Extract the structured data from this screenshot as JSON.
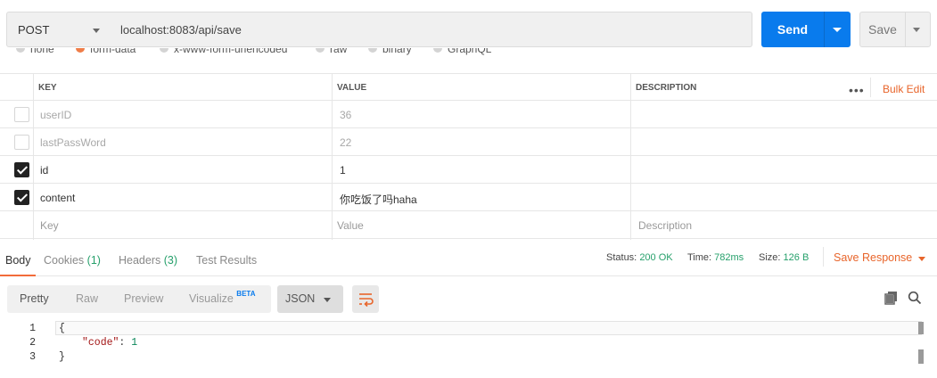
{
  "request": {
    "method": "POST",
    "url": "localhost:8083/api/save",
    "send_label": "Send",
    "save_label": "Save"
  },
  "body_types": [
    {
      "label": "none",
      "selected": false
    },
    {
      "label": "form-data",
      "selected": true
    },
    {
      "label": "x-www-form-urlencoded",
      "selected": false
    },
    {
      "label": "raw",
      "selected": false
    },
    {
      "label": "binary",
      "selected": false
    },
    {
      "label": "GraphQL",
      "selected": false
    }
  ],
  "table": {
    "headers": {
      "key": "KEY",
      "value": "VALUE",
      "description": "DESCRIPTION"
    },
    "more_label": "•••",
    "bulk_edit_label": "Bulk Edit",
    "rows": [
      {
        "checked": false,
        "key": "userID",
        "value": "36",
        "description": ""
      },
      {
        "checked": false,
        "key": "lastPassWord",
        "value": "22",
        "description": ""
      },
      {
        "checked": true,
        "key": "id",
        "value": "1",
        "description": ""
      },
      {
        "checked": true,
        "key": "content",
        "value": "你吃饭了吗haha",
        "description": ""
      }
    ],
    "placeholders": {
      "key": "Key",
      "value": "Value",
      "description": "Description"
    }
  },
  "response": {
    "tabs": [
      {
        "label": "Body",
        "count": ""
      },
      {
        "label": "Cookies",
        "count": "(1)"
      },
      {
        "label": "Headers",
        "count": "(3)"
      },
      {
        "label": "Test Results",
        "count": ""
      }
    ],
    "status_label": "Status:",
    "status_value": "200 OK",
    "time_label": "Time:",
    "time_value": "782ms",
    "size_label": "Size:",
    "size_value": "126 B",
    "save_response_label": "Save Response",
    "view_modes": [
      "Pretty",
      "Raw",
      "Preview",
      "Visualize"
    ],
    "beta_label": "BETA",
    "format": "JSON",
    "code_lines": [
      {
        "num": "1",
        "text": "{"
      },
      {
        "num": "2",
        "key": "\"code\"",
        "sep": ": ",
        "val": "1"
      },
      {
        "num": "3",
        "text": "}"
      }
    ]
  },
  "colors": {
    "accent": "#097bed",
    "brand_orange": "#e8652b",
    "status_green": "#26a06b"
  }
}
